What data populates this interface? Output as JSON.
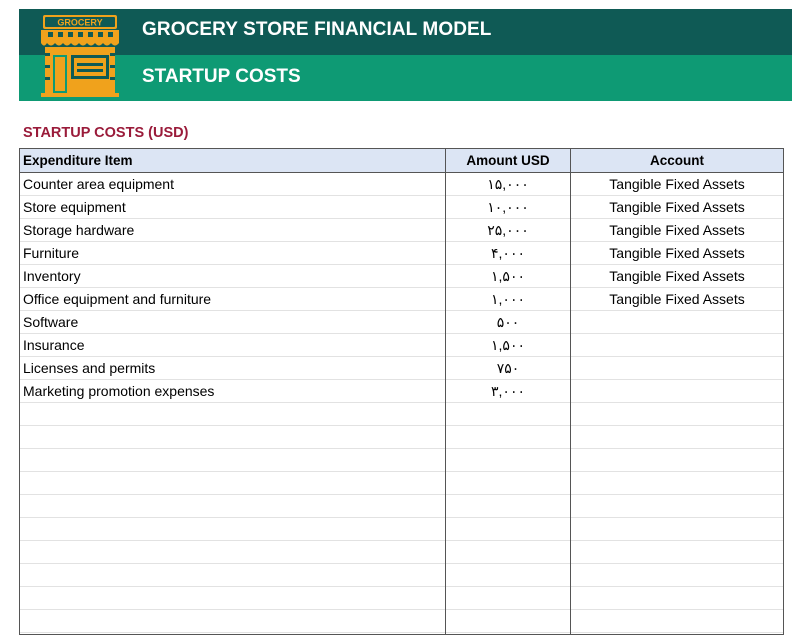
{
  "header": {
    "title": "GROCERY STORE FINANCIAL MODEL",
    "subtitle": "STARTUP COSTS",
    "logo_text": "GROCERY"
  },
  "section": {
    "title": "STARTUP COSTS (USD)"
  },
  "table": {
    "columns": [
      "Expenditure Item",
      "Amount USD",
      "Account"
    ],
    "rows": [
      {
        "item": "Counter area equipment",
        "amount": "۱۵,۰۰۰",
        "account": "Tangible Fixed Assets"
      },
      {
        "item": "Store equipment",
        "amount": "۱۰,۰۰۰",
        "account": "Tangible Fixed Assets"
      },
      {
        "item": "Storage hardware",
        "amount": "۲۵,۰۰۰",
        "account": "Tangible Fixed Assets"
      },
      {
        "item": "Furniture",
        "amount": "۴,۰۰۰",
        "account": "Tangible Fixed Assets"
      },
      {
        "item": "Inventory",
        "amount": "۱,۵۰۰",
        "account": "Tangible Fixed Assets"
      },
      {
        "item": "Office equipment and furniture",
        "amount": "۱,۰۰۰",
        "account": "Tangible Fixed Assets"
      },
      {
        "item": "Software",
        "amount": "۵۰۰",
        "account": ""
      },
      {
        "item": "Insurance",
        "amount": "۱,۵۰۰",
        "account": ""
      },
      {
        "item": "Licenses and permits",
        "amount": "۷۵۰",
        "account": ""
      },
      {
        "item": "Marketing promotion expenses",
        "amount": "۳,۰۰۰",
        "account": ""
      },
      {
        "item": "",
        "amount": "",
        "account": ""
      },
      {
        "item": "",
        "amount": "",
        "account": ""
      },
      {
        "item": "",
        "amount": "",
        "account": ""
      },
      {
        "item": "",
        "amount": "",
        "account": ""
      },
      {
        "item": "",
        "amount": "",
        "account": ""
      },
      {
        "item": "",
        "amount": "",
        "account": ""
      },
      {
        "item": "",
        "amount": "",
        "account": ""
      },
      {
        "item": "",
        "amount": "",
        "account": ""
      },
      {
        "item": "",
        "amount": "",
        "account": ""
      },
      {
        "item": "",
        "amount": "",
        "account": ""
      }
    ]
  },
  "colors": {
    "header_dark": "#0f5a55",
    "header_light": "#0e9a74",
    "section_title": "#9a1b3a",
    "table_header_bg": "#dce5f4",
    "logo_orange": "#f0a21c"
  }
}
